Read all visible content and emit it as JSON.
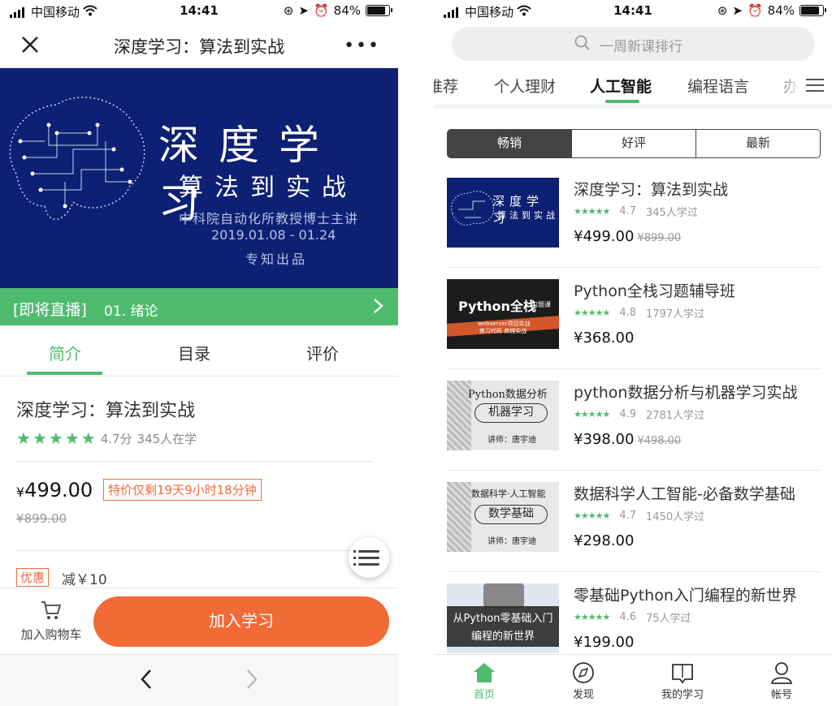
{
  "status": {
    "carrier": "中国移动",
    "time": "14:41",
    "battery": "84%",
    "battery_level": 0.84
  },
  "left": {
    "nav": {
      "title": "深度学习：算法到实战",
      "more": "•••"
    },
    "banner": {
      "title": "深度学习",
      "subtitle": "算法到实战",
      "author": "中科院自动化所教授博士主讲",
      "dates": "2019.01.08 - 01.24",
      "publisher": "专知出品"
    },
    "live": {
      "tag": "[即将直播]",
      "chapter": "01. 绪论"
    },
    "tabs": [
      "简介",
      "目录",
      "评价"
    ],
    "course": {
      "title": "深度学习：算法到实战",
      "rating": "4.7分",
      "learners": "345人在学",
      "price_symbol": "¥",
      "price": "499.00",
      "promo": "特价仅剩19天9小时18分钟",
      "original_price": "¥899.00",
      "discount_tag": "优惠",
      "discount": "减￥10"
    },
    "bottom": {
      "cart_label": "加入购物车",
      "join_label": "加入学习"
    }
  },
  "right": {
    "search_placeholder": "一周新课排行",
    "categories": [
      "推荐",
      "个人理财",
      "人工智能",
      "编程语言",
      "办"
    ],
    "active_category": "人工智能",
    "sort_tabs": [
      "畅销",
      "好评",
      "最新"
    ],
    "courses": [
      {
        "title": "深度学习：算法到实战",
        "rating": "4.7",
        "learners": "345人学过",
        "price": "¥499.00",
        "original": "¥899.00",
        "thumb_text": "深度学习",
        "thumb_sub": "算法到实战"
      },
      {
        "title": "Python全栈习题辅导班",
        "rating": "4.8",
        "learners": "1797人学过",
        "price": "¥368.00",
        "original": "",
        "thumb_text": "Python全栈",
        "thumb_sub": "习题课",
        "thumb_tag": "webserver项目实战",
        "thumb_tag2": "练习代码 商城实战"
      },
      {
        "title": "python数据分析与机器学习实战",
        "rating": "4.9",
        "learners": "2781人学过",
        "price": "¥398.00",
        "original": "¥498.00",
        "thumb_text": "Python数据分析",
        "thumb_sub": "机器学习",
        "thumb_tag": "讲师：唐宇迪"
      },
      {
        "title": "数据科学人工智能-必备数学基础",
        "rating": "4.7",
        "learners": "1450人学过",
        "price": "¥298.00",
        "original": "",
        "thumb_text": "数据科学·人工智能",
        "thumb_sub": "数学基础",
        "thumb_tag": "讲师：唐宇迪"
      },
      {
        "title": "零基础Python入门编程的新世界",
        "rating": "4.6",
        "learners": "75人学过",
        "price": "¥199.00",
        "original": "",
        "thumb_text": "从Python零基础入门",
        "thumb_sub": "编程的新世界"
      }
    ],
    "tabbar": [
      "首页",
      "发现",
      "我的学习",
      "帐号"
    ]
  },
  "colors": {
    "accent": "#4fbb6e",
    "orange": "#f26a35",
    "banner_bg": "#0d2073"
  }
}
